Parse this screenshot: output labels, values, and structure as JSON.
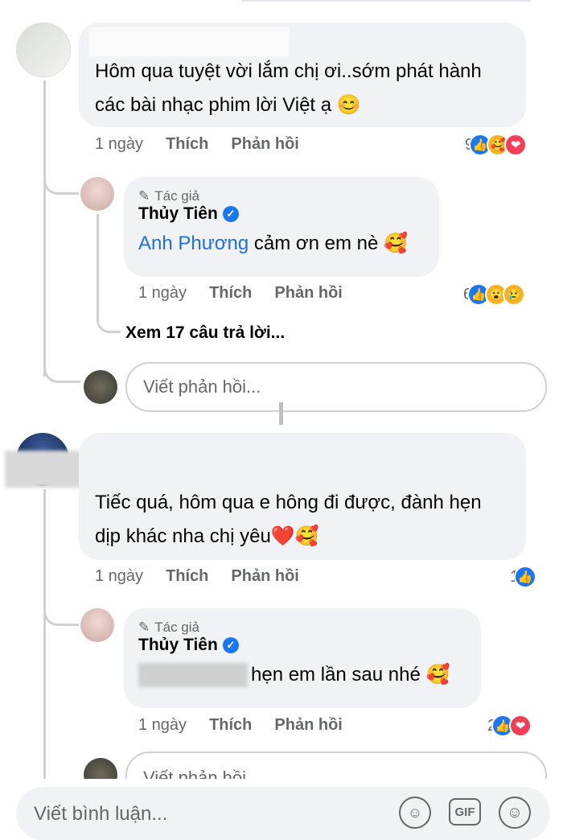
{
  "comment1": {
    "text": "Hôm qua tuyệt vời lắm chị ơi..sớm phát hành các bài nhạc phim lời Việt ạ 😊",
    "time": "1 ngày",
    "like": "Thích",
    "reply": "Phản hồi",
    "reaction_count": "9"
  },
  "reply1": {
    "author_tag": "Tác giả",
    "author": "Thủy Tiên",
    "mention": "Anh Phương",
    "text": "cảm ơn em nè 🥰",
    "time": "1 ngày",
    "like": "Thích",
    "reply": "Phản hồi",
    "reaction_count": "6"
  },
  "view_more": "Xem 17 câu trả lời...",
  "reply_placeholder": "Viết phản hồi...",
  "comment2": {
    "text": "Tiếc quá, hôm qua e hông đi được, đành hẹn dịp khác nha chị yêu❤️🥰",
    "time": "1 ngày",
    "like": "Thích",
    "reply": "Phản hồi",
    "reaction_count": "1"
  },
  "reply2": {
    "author_tag": "Tác giả",
    "author": "Thủy Tiên",
    "text": "hẹn em lần sau nhé 🥰",
    "time": "1 ngày",
    "like": "Thích",
    "reply": "Phản hồi",
    "reaction_count": "2"
  },
  "reply_placeholder2": "Viết phản hồi...",
  "comment_placeholder": "Viết bình luận...",
  "gif_label": "GIF",
  "colors": {
    "like_blue": "#1877f2",
    "love_red": "#f33e58",
    "haha_yellow": "#f7b125"
  }
}
